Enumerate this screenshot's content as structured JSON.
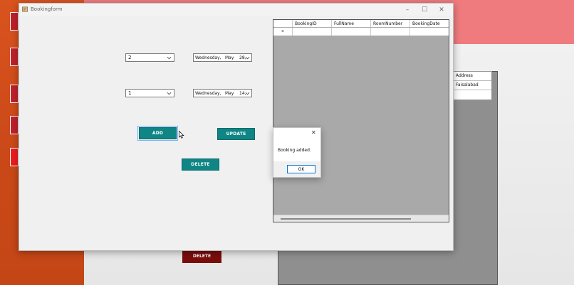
{
  "window": {
    "title": "Bookingform",
    "controls": {
      "minimize": "–",
      "maximize": "☐",
      "close": "✕"
    }
  },
  "form": {
    "combo1": {
      "value": "2"
    },
    "combo2": {
      "value": "1"
    },
    "date1": {
      "weekday": "Wednesday,",
      "month": "May",
      "day": "28,"
    },
    "date2": {
      "weekday": "Wednesday,",
      "month": "May",
      "day": "14,"
    }
  },
  "buttons": {
    "add": "ADD",
    "update": "UPDATE",
    "delete": "DELETE"
  },
  "grid": {
    "columns": [
      "BookingID",
      "FullName",
      "RoomNumber",
      "BookingDate"
    ],
    "new_row_marker": "*"
  },
  "messagebox": {
    "message": "Booking added.",
    "ok": "OK",
    "close": "✕"
  },
  "background": {
    "address_header": "Address",
    "address_value": "Faisalabad",
    "delete_button": "DELETE"
  },
  "colors": {
    "teal": "#0f8585",
    "orange": "#d9531e",
    "pink": "#f07b7e",
    "dark_red": "#7a0c0c"
  }
}
